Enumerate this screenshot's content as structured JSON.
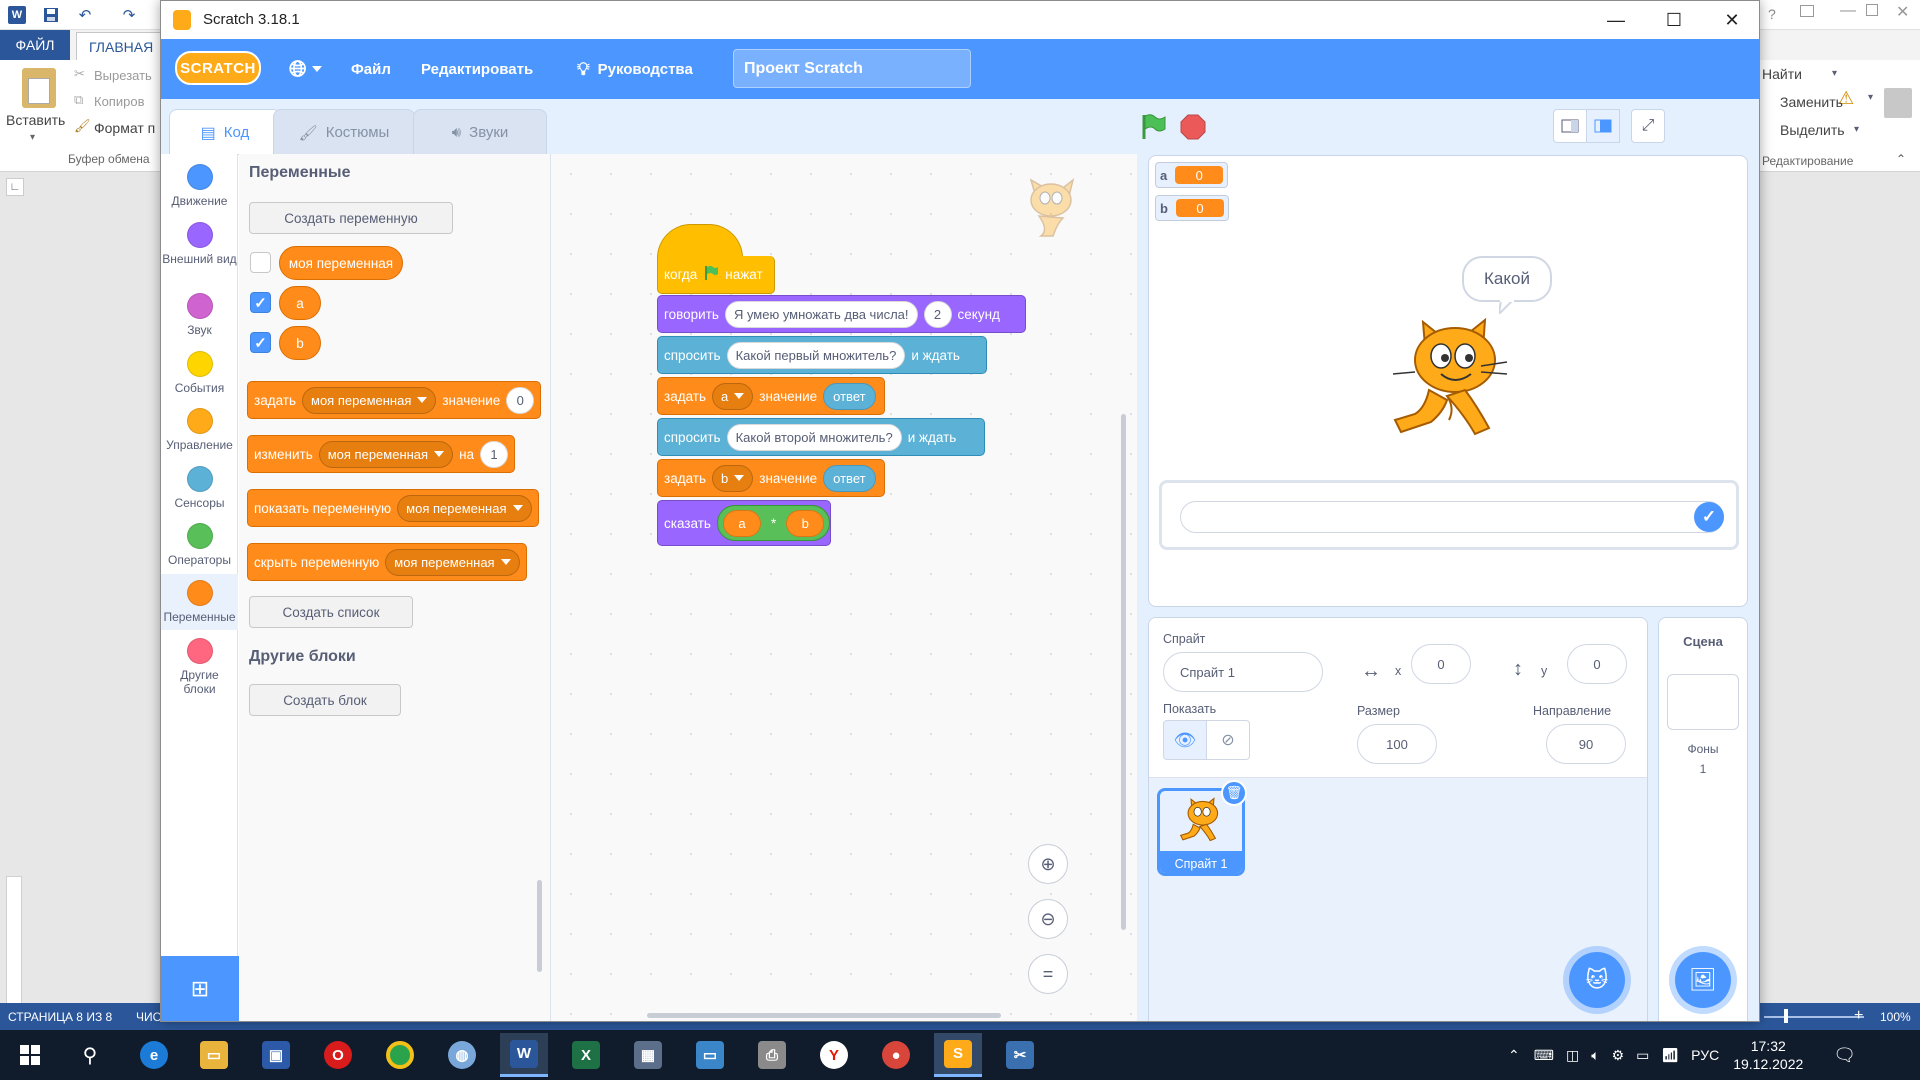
{
  "word": {
    "qat_undo": "↶",
    "qat_redo": "↷",
    "tab_file": "ФАЙЛ",
    "tab_home": "ГЛАВНАЯ",
    "paste_label": "Вставить",
    "cut_label": "Вырезать",
    "copy_label": "Копиров",
    "format_label": "Формат п",
    "clipboard_group": "Буфер обмена",
    "find_label": "Найти",
    "replace_label": "Заменить",
    "select_label": "Выделить",
    "editing_group": "Редактирование",
    "status_page": "СТРАНИЦА 8 ИЗ 8",
    "status_words": "ЧИС",
    "zoom": "100%"
  },
  "window": {
    "title": "Scratch 3.18.1",
    "minimize": "—",
    "maximize": "☐",
    "close": "✕"
  },
  "menu": {
    "logo": "SCRATCH",
    "file": "Файл",
    "edit": "Редактировать",
    "tutorials": "Руководства",
    "project_title": "Проект Scratch"
  },
  "tabs": {
    "code": "Код",
    "costumes": "Костюмы",
    "sounds": "Звуки"
  },
  "categories": [
    {
      "label": "Движение",
      "color": "#4c97ff"
    },
    {
      "label": "Внешний вид",
      "color": "#9966ff"
    },
    {
      "label": "Звук",
      "color": "#cf63cf"
    },
    {
      "label": "События",
      "color": "#ffd500"
    },
    {
      "label": "Управление",
      "color": "#ffab19"
    },
    {
      "label": "Сенсоры",
      "color": "#5cb1d6"
    },
    {
      "label": "Операторы",
      "color": "#59c059"
    },
    {
      "label": "Переменные",
      "color": "#ff8c1a"
    },
    {
      "label": "Другие блоки",
      "color": "#ff6680"
    }
  ],
  "palette": {
    "section_variables": "Переменные",
    "make_variable": "Создать переменную",
    "var_my": "моя переменная",
    "var_a": "a",
    "var_b": "b",
    "set_label": "задать",
    "to_label": "значение",
    "set_value": "0",
    "change_label": "изменить",
    "by_label": "на",
    "change_value": "1",
    "show_label": "показать переменную",
    "hide_label": "скрыть переменную",
    "make_list": "Создать список",
    "section_more": "Другие блоки",
    "make_block": "Создать блок"
  },
  "script": {
    "when_flag": "когда",
    "clicked": "нажат",
    "say_for": "говорить",
    "say_text": "Я умею умножать два числа!",
    "say_secs": "2",
    "secs_label": "секунд",
    "ask": "спросить",
    "ask1_text": "Какой первый множитель?",
    "and_wait": "и ждать",
    "set": "задать",
    "var_a": "a",
    "var_b": "b",
    "to": "значение",
    "answer": "ответ",
    "ask2_text": "Какой второй множитель?",
    "say": "сказать",
    "op_left": "a",
    "op_sign": "*",
    "op_right": "b"
  },
  "workspace": {
    "zoom_in": "+",
    "zoom_out": "−",
    "zoom_reset": "="
  },
  "stage": {
    "monitor_a_name": "a",
    "monitor_a_value": "0",
    "monitor_b_name": "b",
    "monitor_b_value": "0",
    "speech": "Какой",
    "answer_value": ""
  },
  "sprite": {
    "sprite_label": "Спрайт",
    "sprite_name": "Спрайт 1",
    "x_label": "x",
    "x_value": "0",
    "y_label": "y",
    "y_value": "0",
    "show_label": "Показать",
    "size_label": "Размер",
    "size_value": "100",
    "direction_label": "Направление",
    "direction_value": "90",
    "thumb_name": "Спрайт 1"
  },
  "stage_pane": {
    "title": "Сцена",
    "backdrops_label": "Фоны",
    "backdrops_count": "1"
  },
  "taskbar": {
    "lang": "РУС",
    "time": "17:32",
    "date": "19.12.2022"
  },
  "colors": {
    "scratch_blue": "#4c97ff",
    "variables_orange": "#ff8c1a",
    "looks_purple": "#9966ff",
    "sensing_blue": "#5cb1d6",
    "events_yellow": "#ffbf00",
    "green_flag": "#4cbf56",
    "stop_red": "#ec5959",
    "word_blue": "#2b579a"
  }
}
